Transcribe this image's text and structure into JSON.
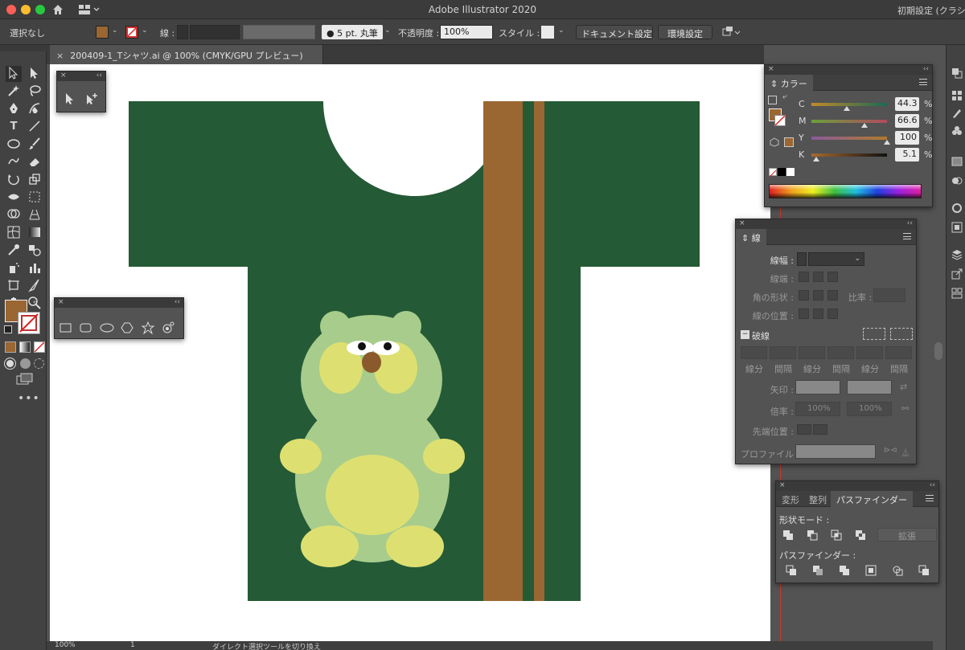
{
  "window": {
    "app_title": "Adobe Illustrator 2020",
    "workspace": "初期設定 (クラシック)"
  },
  "control_bar": {
    "selection": "選択なし",
    "stroke_label": "線 :",
    "brush": "5 pt. 丸筆",
    "opacity_label": "不透明度 :",
    "opacity_value": "100%",
    "style_label": "スタイル :",
    "document_setup": "ドキュメント設定",
    "preferences": "環境設定"
  },
  "document": {
    "tab_title": "200409-1_Tシャツ.ai @ 100% (CMYK/GPU プレビュー)",
    "tab_close": "×"
  },
  "status_bar": {
    "zoom": "100%",
    "artboard": "1",
    "message": "ダイレクト選択ツールを切り換え"
  },
  "color_panel": {
    "title": "カラー",
    "channels": [
      {
        "label": "C",
        "value": "44.3",
        "percent": 44.3
      },
      {
        "label": "M",
        "value": "66.6",
        "percent": 66.6
      },
      {
        "label": "Y",
        "value": "100",
        "percent": 100
      },
      {
        "label": "K",
        "value": "5.1",
        "percent": 5.1
      }
    ],
    "pct": "%",
    "fill_color": "#9a6632"
  },
  "stroke_panel": {
    "title": "線",
    "weight_label": "線幅 :",
    "cap_label": "線端 :",
    "corner_label": "角の形状 :",
    "limit_label": "比率 :",
    "align_label": "線の位置 :",
    "dashed_label": "破線",
    "dash_labels": [
      "線分",
      "間隔",
      "線分",
      "間隔",
      "線分",
      "間隔"
    ],
    "arrow_label": "矢印 :",
    "scale_label": "倍率 :",
    "scale_values": [
      "100%",
      "100%"
    ],
    "tip_label": "先端位置 :",
    "profile_label": "プロファイル :"
  },
  "pathfinder_panel": {
    "tabs": [
      "変形",
      "整列",
      "パスファインダー"
    ],
    "shape_modes_label": "形状モード :",
    "expand": "拡張",
    "pathfinders_label": "パスファインダー :"
  },
  "colors": {
    "shirt": "#245a36",
    "stripe": "#9a6632",
    "bear_body": "#a8cc8c",
    "bear_belly": "#dde070",
    "bear_nose": "#8a5a2c"
  }
}
